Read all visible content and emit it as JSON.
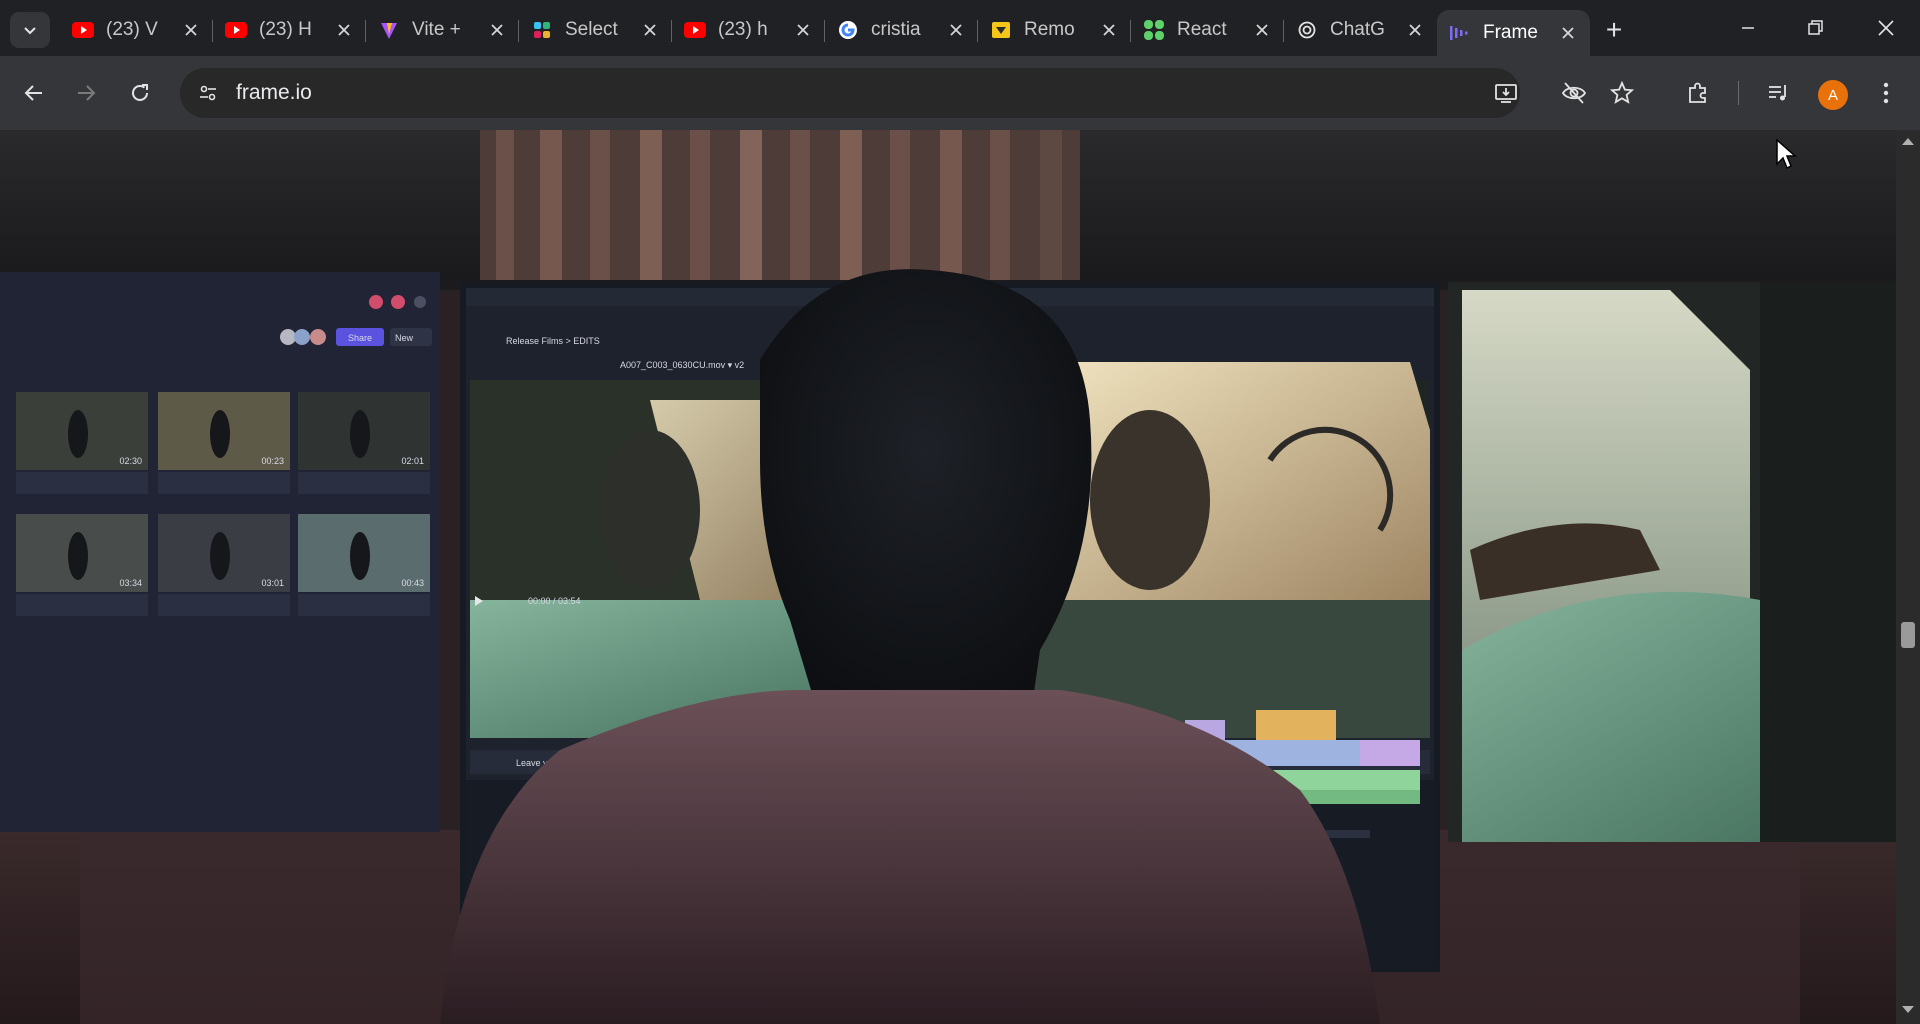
{
  "browser": {
    "tabs": [
      {
        "title": "(23) V",
        "icon": "youtube-icon",
        "active": false
      },
      {
        "title": "(23) H",
        "icon": "youtube-icon",
        "active": false
      },
      {
        "title": "Vite +",
        "icon": "vite-icon",
        "active": false
      },
      {
        "title": "Select",
        "icon": "slack-icon",
        "active": false
      },
      {
        "title": "(23) h",
        "icon": "youtube-icon",
        "active": false
      },
      {
        "title": "cristia",
        "icon": "google-icon",
        "active": false
      },
      {
        "title": "Remo",
        "icon": "remotion-icon",
        "active": false
      },
      {
        "title": "React",
        "icon": "react-flow-icon",
        "active": false
      },
      {
        "title": "ChatG",
        "icon": "openai-icon",
        "active": false
      },
      {
        "title": "Frame",
        "icon": "frameio-icon",
        "active": true
      }
    ],
    "url": "frame.io",
    "profile_initial": "A",
    "colors": {
      "profile": "#e8710a",
      "accent": "#7c6cf6"
    }
  },
  "hero": {
    "media_panel": {
      "share_label": "Share",
      "new_label": "New",
      "clips": [
        {
          "duration": "02:30"
        },
        {
          "duration": "00:23"
        },
        {
          "duration": "02:01"
        },
        {
          "duration": "03:34"
        },
        {
          "duration": "03:01"
        },
        {
          "duration": "00:43"
        }
      ]
    },
    "player": {
      "breadcrumb": "Release Films  >  EDITS",
      "clip_name": "A007_C003_0630CU.mov  ▾  v2",
      "timecode": "00:00 / 03:54",
      "comment_placeholder": "Leave your comment here..."
    }
  }
}
